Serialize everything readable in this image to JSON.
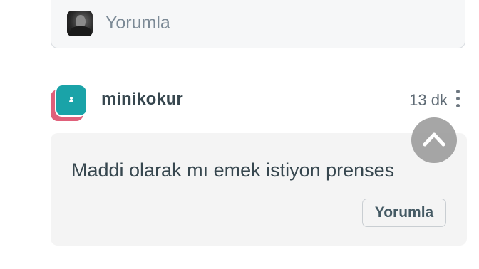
{
  "comment_input": {
    "placeholder": "Yorumla"
  },
  "comment": {
    "username": "minikokur",
    "timestamp": "13 dk",
    "text": "Maddi olarak mı emek istiyon prenses",
    "reply_label": "Yorumla"
  },
  "colors": {
    "avatar_primary": "#1aa3a8",
    "avatar_accent": "#e0607a",
    "text_primary": "#37474f",
    "bubble_bg": "#f4f4f4"
  },
  "icons": {
    "more": "more-vertical-icon",
    "scroll_top": "chevron-up-icon"
  }
}
